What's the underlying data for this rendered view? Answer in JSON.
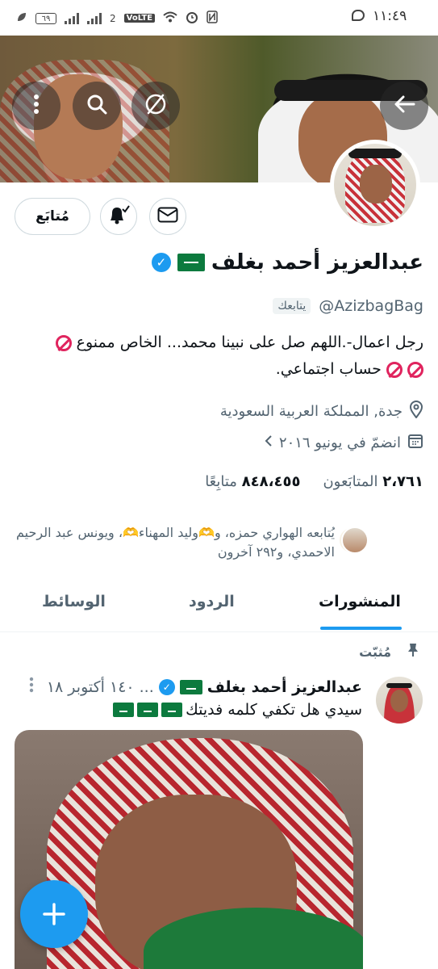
{
  "status_bar": {
    "time": "١١:٤٩",
    "battery": "٦٩",
    "network": "VoLTE",
    "sim_slot": "2",
    "icons": [
      "chat-bubble-icon",
      "nfc-icon",
      "alarm-icon",
      "wifi-icon",
      "signal-icon",
      "battery-icon",
      "leaf-icon"
    ]
  },
  "header": {
    "icons": [
      "back-arrow-icon",
      "explore-icon",
      "search-icon",
      "more-vertical-icon"
    ]
  },
  "actions": {
    "follow_label": "مُتابَع",
    "icons": [
      "mail-icon",
      "bell-icon"
    ]
  },
  "profile": {
    "display_name": "عبدالعزيز أحمد بغلف",
    "handle": "@AzizbagBag",
    "follows_you": "يتابعك",
    "bio_line1": "رجل اعمال-.اللهم صل على نبينا محمد... الخاص ممنوع",
    "bio_line2": "حساب اجتماعي.",
    "location": "جدة, المملكة العربية السعودية",
    "joined": "انضمّ في يونيو ٢٠١٦",
    "following_count": "٢،٧٦١",
    "following_label": "المتابَعون",
    "followers_count": "٨٤٨،٤٥٥",
    "followers_label": "متابِعًا",
    "followed_by": "يُتابعه الهواري حمزه، و🫶وليد المهناء🫶، ويونس عبد الرحيم الاحمدي، و٢٩٢ آخرون"
  },
  "tabs": [
    {
      "label": "المنشورات",
      "active": true
    },
    {
      "label": "الردود",
      "active": false
    },
    {
      "label": "الوسائط",
      "active": false
    }
  ],
  "pinned_tweet": {
    "pinned_label": "مُثبّت",
    "author": "عبدالعزيز أحمد بغلف",
    "date": "١٤٠ أكتوبر ١٨",
    "text": "سيدي هل تكفي كلمه فديتك"
  },
  "colors": {
    "accent": "#1d9bf0",
    "text": "#0f1419",
    "muted": "#536471",
    "border": "#cfd9de"
  }
}
